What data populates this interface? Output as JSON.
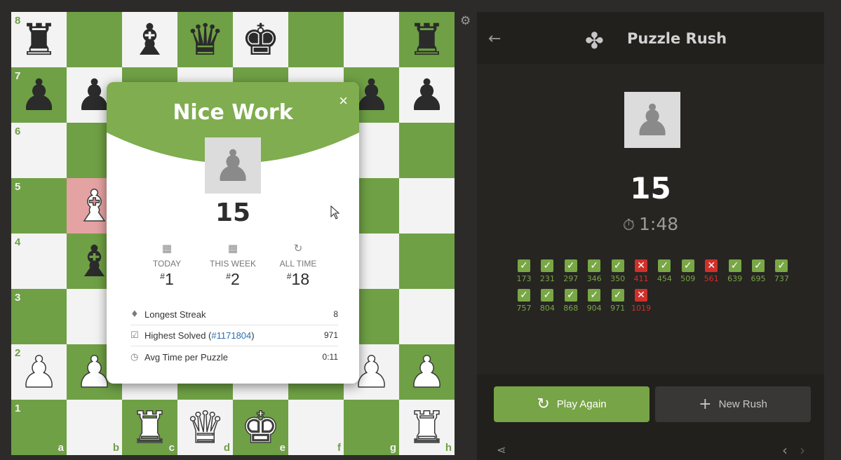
{
  "board": {
    "ranks": [
      "8",
      "7",
      "6",
      "5",
      "4",
      "3",
      "2",
      "1"
    ],
    "files": [
      "a",
      "b",
      "c",
      "d",
      "e",
      "f",
      "g",
      "h"
    ],
    "highlight": [
      "b5"
    ],
    "pieces": {
      "a8": "bR",
      "c8": "bB",
      "d8": "bQ",
      "e8": "bK",
      "h8": "bR",
      "a7": "bP",
      "b7": "bP",
      "g7": "bP",
      "h7": "bP",
      "b5": "wB",
      "b4": "bB",
      "a2": "wP",
      "b2": "wP",
      "g2": "wP",
      "h2": "wP",
      "c1": "wR",
      "d1": "wQ",
      "e1": "wK",
      "h1": "wR"
    },
    "piece_glyphs": {
      "bR": "♜",
      "bB": "♝",
      "bQ": "♛",
      "bK": "♚",
      "bP": "♟",
      "wR": "♜",
      "wB": "♝",
      "wQ": "♛",
      "wK": "♚",
      "wP": "♟"
    }
  },
  "settings_icon": "gear-icon",
  "modal": {
    "title": "Nice Work",
    "close": "×",
    "avatar_icon": "pawn-icon",
    "score": "15",
    "ranks": [
      {
        "icon": "calendar-icon",
        "label": "TODAY",
        "value": "1"
      },
      {
        "icon": "calendar-icon",
        "label": "THIS WEEK",
        "value": "2"
      },
      {
        "icon": "refresh-icon",
        "label": "ALL TIME",
        "value": "18"
      }
    ],
    "stats": {
      "longest_streak_label": "Longest Streak",
      "longest_streak_value": "8",
      "highest_solved_label": "Highest Solved (",
      "highest_solved_link": "#1171804",
      "highest_solved_close": ")",
      "highest_solved_value": "971",
      "avg_time_label": "Avg Time per Puzzle",
      "avg_time_value": "0:11"
    },
    "colors": {
      "header": "#7fad4f"
    }
  },
  "panel": {
    "title": "Puzzle Rush",
    "back_icon": "arrow-left-icon",
    "logo_icon": "puzzle-piece-icon",
    "score": "15",
    "timer": "1:48",
    "results": [
      {
        "n": "173",
        "ok": true
      },
      {
        "n": "231",
        "ok": true
      },
      {
        "n": "297",
        "ok": true
      },
      {
        "n": "346",
        "ok": true
      },
      {
        "n": "350",
        "ok": true
      },
      {
        "n": "411",
        "ok": false
      },
      {
        "n": "454",
        "ok": true
      },
      {
        "n": "509",
        "ok": true
      },
      {
        "n": "561",
        "ok": false
      },
      {
        "n": "639",
        "ok": true
      },
      {
        "n": "695",
        "ok": true
      },
      {
        "n": "737",
        "ok": true
      },
      {
        "n": "757",
        "ok": true
      },
      {
        "n": "804",
        "ok": true
      },
      {
        "n": "868",
        "ok": true
      },
      {
        "n": "904",
        "ok": true
      },
      {
        "n": "971",
        "ok": true
      },
      {
        "n": "1019",
        "ok": false
      }
    ],
    "play_again": "Play Again",
    "new_rush": "New Rush",
    "colors": {
      "correct": "#79a745",
      "wrong": "#d0302a",
      "play_button": "#77a446"
    }
  }
}
